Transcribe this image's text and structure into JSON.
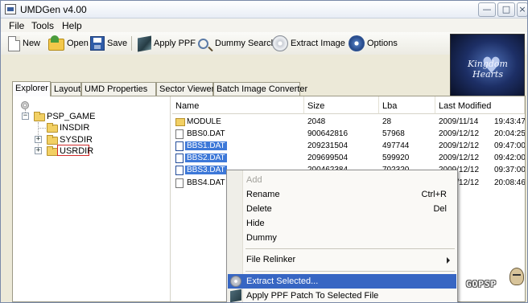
{
  "window": {
    "title": "UMDGen v4.00",
    "min_glyph": "—",
    "max_glyph": "□",
    "close_glyph": "×"
  },
  "menu": {
    "file": "File",
    "tools": "Tools",
    "help": "Help"
  },
  "toolbar": {
    "new": "New",
    "open": "Open",
    "save": "Save",
    "apply_ppf": "Apply PPF",
    "dummy_search": "Dummy Search",
    "extract_image": "Extract Image",
    "options": "Options"
  },
  "tabs": [
    "Explorer",
    "Layout",
    "UMD Properties",
    "Sector Viewer",
    "Batch Image Converter"
  ],
  "tree": {
    "root": "PSP_GAME",
    "children": [
      "INSDIR",
      "SYSDIR",
      "USRDIR"
    ],
    "highlighted": "USRDIR"
  },
  "files": {
    "columns": [
      "Name",
      "Size",
      "Lba",
      "Last Modified"
    ],
    "rows": [
      {
        "name": "MODULE",
        "size": "2048",
        "lba": "28",
        "date": "2009/11/14",
        "time": "19:43:47",
        "type": "folder"
      },
      {
        "name": "BBS0.DAT",
        "size": "900642816",
        "lba": "57968",
        "date": "2009/12/12",
        "time": "20:04:25",
        "type": "file"
      },
      {
        "name": "BBS1.DAT",
        "size": "209231504",
        "lba": "497744",
        "date": "2009/12/12",
        "time": "09:47:00",
        "type": "file",
        "selected": true
      },
      {
        "name": "BBS2.DAT",
        "size": "209699504",
        "lba": "599920",
        "date": "2009/12/12",
        "time": "09:42:00",
        "type": "file",
        "selected": true
      },
      {
        "name": "BBS3.DAT",
        "size": "200462384",
        "lba": "702320",
        "date": "2009/12/12",
        "time": "09:37:00",
        "type": "file",
        "selected": true
      },
      {
        "name": "BBS4.DAT",
        "size": "",
        "lba": "",
        "date": "2009/12/12",
        "time": "20:08:46",
        "type": "file"
      }
    ]
  },
  "context_menu": {
    "add": "Add",
    "rename": "Rename",
    "rename_shortcut": "Ctrl+R",
    "delete": "Delete",
    "delete_shortcut": "Del",
    "hide": "Hide",
    "dummy": "Dummy",
    "file_relinker": "File Relinker",
    "extract_selected": "Extract Selected...",
    "apply_ppf_patch": "Apply PPF Patch To Selected File"
  },
  "logo": {
    "text": "Kingdom Hearts",
    "heart": "♥"
  },
  "watermark": {
    "text": "GOPSP"
  },
  "colors": {
    "selection": "#3d78d8",
    "menu_highlight": "#3766c3",
    "tree_highlight_border": "#d12a2a"
  }
}
